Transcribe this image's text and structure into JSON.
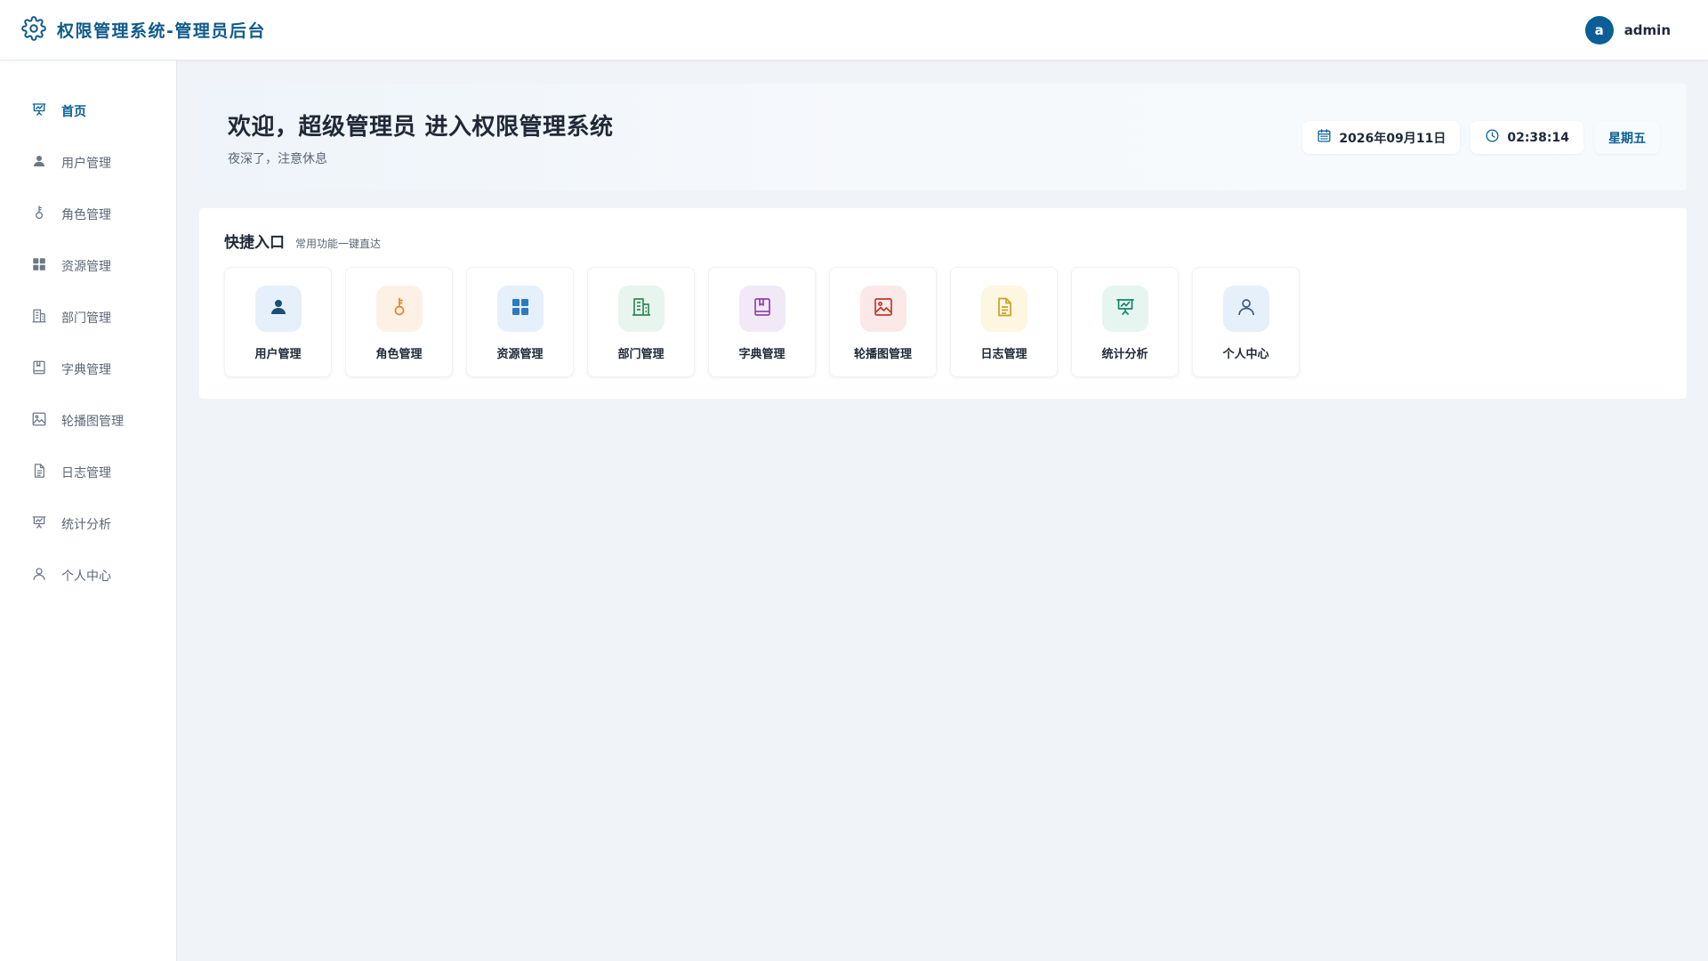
{
  "header": {
    "title": "权限管理系统-管理员后台",
    "avatar_letter": "a",
    "username": "admin"
  },
  "sidebar": {
    "items": [
      {
        "label": "首页",
        "icon": "presentation-chart-icon",
        "active": true
      },
      {
        "label": "用户管理",
        "icon": "user-icon"
      },
      {
        "label": "角色管理",
        "icon": "key-icon"
      },
      {
        "label": "资源管理",
        "icon": "grid-icon"
      },
      {
        "label": "部门管理",
        "icon": "building-icon"
      },
      {
        "label": "字典管理",
        "icon": "book-icon"
      },
      {
        "label": "轮播图管理",
        "icon": "image-icon"
      },
      {
        "label": "日志管理",
        "icon": "document-icon"
      },
      {
        "label": "统计分析",
        "icon": "presentation-chart-icon"
      },
      {
        "label": "个人中心",
        "icon": "person-outline-icon"
      }
    ]
  },
  "welcome": {
    "title": "欢迎，超级管理员 进入权限管理系统",
    "subtitle": "夜深了，注意休息",
    "date": "2026年09月11日",
    "time": "02:38:14",
    "weekday": "星期五"
  },
  "quick": {
    "title": "快捷入口",
    "subtitle": "常用功能一键直达",
    "cards": [
      {
        "label": "用户管理",
        "icon": "user-icon",
        "bg": "#e6f0fa",
        "color": "#1d4f73"
      },
      {
        "label": "角色管理",
        "icon": "key-icon",
        "bg": "#fdf1e5",
        "color": "#e8812a"
      },
      {
        "label": "资源管理",
        "icon": "grid-icon",
        "bg": "#e6f0fa",
        "color": "#2b7bbf"
      },
      {
        "label": "部门管理",
        "icon": "building-icon",
        "bg": "#e8f5ee",
        "color": "#2e8b57"
      },
      {
        "label": "字典管理",
        "icon": "book-icon",
        "bg": "#f2e9f7",
        "color": "#8e44ad"
      },
      {
        "label": "轮播图管理",
        "icon": "image-icon",
        "bg": "#fbe9e9",
        "color": "#c0392b"
      },
      {
        "label": "日志管理",
        "icon": "document-icon",
        "bg": "#fdf6e0",
        "color": "#c9a227"
      },
      {
        "label": "统计分析",
        "icon": "presentation-chart-icon",
        "bg": "#e6f5f0",
        "color": "#16836a"
      },
      {
        "label": "个人中心",
        "icon": "person-outline-icon",
        "bg": "#e6f0fa",
        "color": "#3d5a80"
      }
    ]
  },
  "colors": {
    "primary": "#0b5f96",
    "brand_text": "#0f5a8c",
    "background": "#f0f3f7",
    "sidebar_icon": "#6b7785"
  }
}
